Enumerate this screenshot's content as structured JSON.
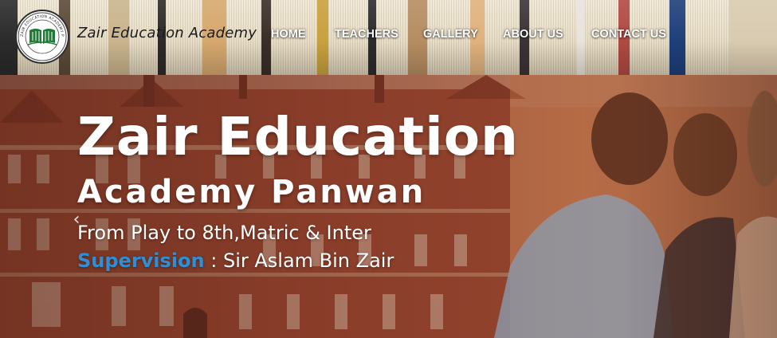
{
  "header": {
    "brand_name": "Zair Education Academy",
    "logo_text": "ZAIR EDUCATION ACADEMY PANWAN",
    "nav": [
      {
        "label": "HOME"
      },
      {
        "label": "TEACHERS"
      },
      {
        "label": "GALLERY"
      },
      {
        "label": "ABOUT US"
      },
      {
        "label": "CONTACT US"
      }
    ]
  },
  "hero": {
    "title": "Zair Education",
    "subtitle": "Academy Panwan",
    "tagline": "From Play to 8th,Matric & Inter",
    "supervision_label": "Supervision",
    "supervision_separator": " : ",
    "supervision_name": "Sir Aslam Bin Zair",
    "prev_arrow": "‹"
  },
  "colors": {
    "nav_text": "#ffffff",
    "supervision_accent": "#2f8fd6",
    "hero_base": "#93482f",
    "logo_green": "#1e7a34"
  },
  "icons": {
    "logo": "open-book-emblem",
    "prev": "chevron-left-icon"
  }
}
